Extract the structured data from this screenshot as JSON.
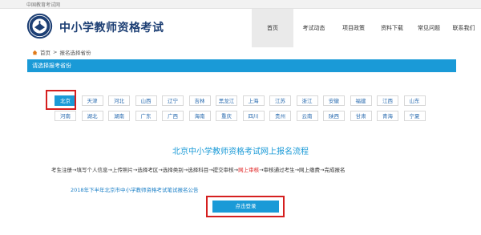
{
  "topbar": {
    "text": "中国教育考试网"
  },
  "header": {
    "title": "中小学教师资格考试"
  },
  "nav": [
    {
      "label": "首页",
      "active": true
    },
    {
      "label": "考试动态",
      "active": false
    },
    {
      "label": "项目政策",
      "active": false
    },
    {
      "label": "资料下载",
      "active": false
    },
    {
      "label": "常见问题",
      "active": false
    },
    {
      "label": "联系我们",
      "active": false
    }
  ],
  "breadcrumb": {
    "home": "首页",
    "separator": ">",
    "current": "报名选择省份"
  },
  "section": {
    "title": "请选择报考省份"
  },
  "provinces_row1": [
    "北京",
    "天津",
    "河北",
    "山西",
    "辽宁",
    "吉林",
    "黑龙江",
    "上海",
    "江苏",
    "浙江",
    "安徽",
    "福建",
    "江西",
    "山东"
  ],
  "provinces_row2": [
    "河南",
    "湖北",
    "湖南",
    "广东",
    "广西",
    "海南",
    "重庆",
    "四川",
    "贵州",
    "云南",
    "陕西",
    "甘肃",
    "青海",
    "宁夏"
  ],
  "selected_province": "北京",
  "process": {
    "title": "北京中小学教师资格考试网上报名流程",
    "steps_before": "考生注册→填写个人信息→上传照片→选择考区→选择类别→选择科目→提交审核→",
    "steps_red": "网上审核",
    "steps_after": "→审核通过考生→网上缴费→完成报名"
  },
  "notice": "2018年下半年北京市中小学教师资格考试笔试报名公告",
  "login_button": "点击登录",
  "colors": {
    "accent": "#1a9ad7",
    "highlight": "#d51f1f",
    "title": "#1d3f74"
  }
}
